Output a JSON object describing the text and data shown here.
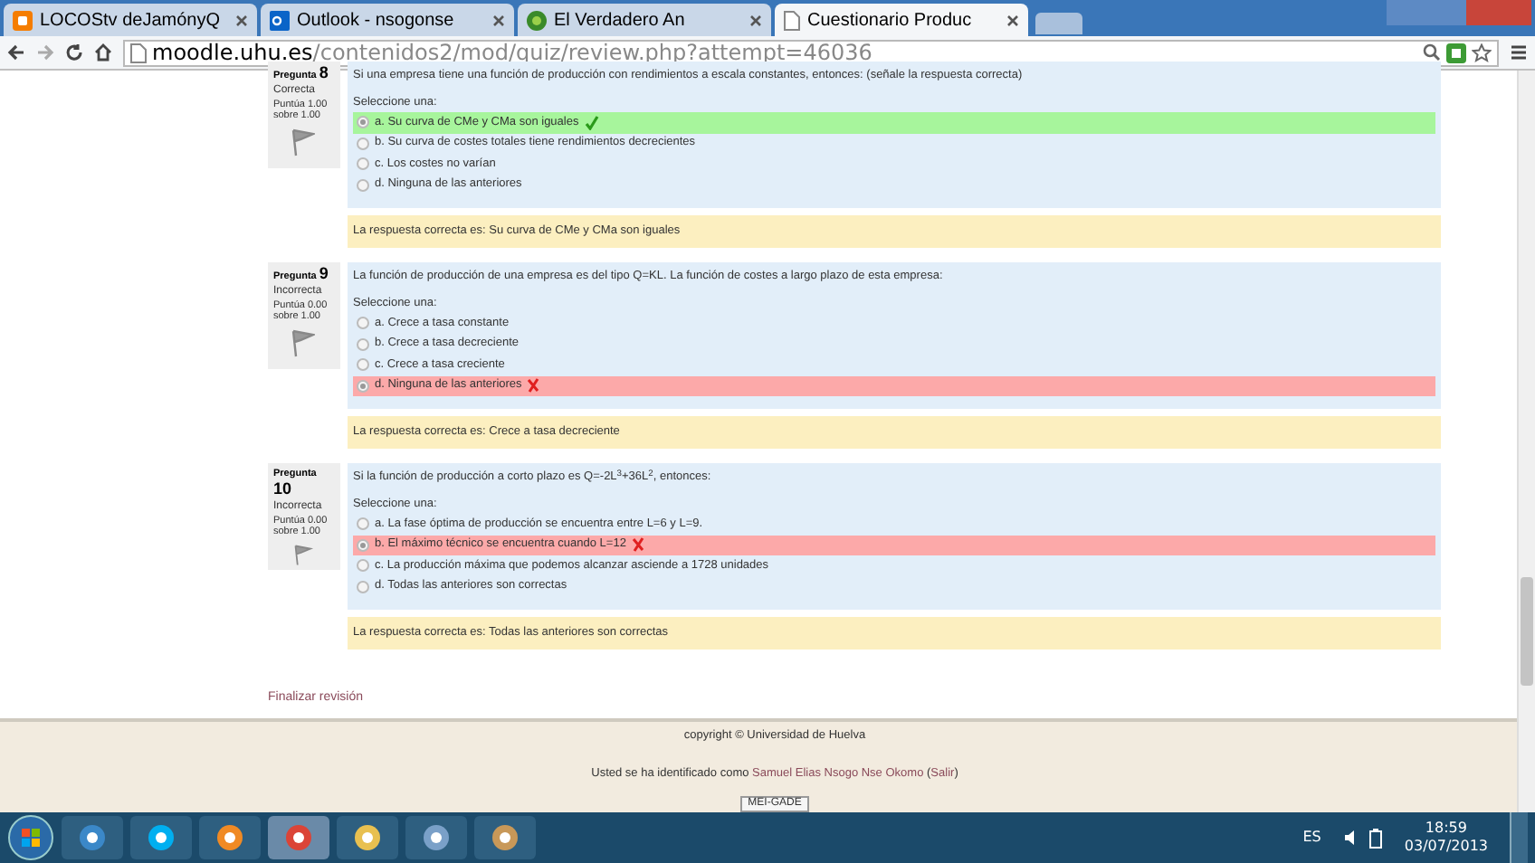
{
  "browser": {
    "tabs": [
      {
        "title": "LOCOStv deJamónyQ",
        "selected": false,
        "kind": "blogger"
      },
      {
        "title": "Outlook - nsogonse",
        "selected": false,
        "kind": "outlook"
      },
      {
        "title": "El Verdadero An",
        "selected": false,
        "kind": "frog"
      },
      {
        "title": "Cuestionario Produc",
        "selected": true,
        "kind": "page"
      }
    ],
    "url_host": "moodle.uhu.es",
    "url_path": "/contenidos2/mod/quiz/review.php?attempt=46036"
  },
  "questions": [
    {
      "label": "Pregunta",
      "number": "8",
      "state": "Correcta",
      "score": "Puntúa 1.00 sobre 1.00",
      "text": "Si una empresa tiene una función de producción con rendimientos a escala constantes, entonces: (señale la respuesta correcta)",
      "prompt": "Seleccione una:",
      "options": [
        {
          "text": "a. Su curva de CMe y CMa son iguales",
          "selected": true,
          "kind": "correct"
        },
        {
          "text": "b. Su curva de costes totales tiene rendimientos decrecientes",
          "selected": false,
          "kind": "plain"
        },
        {
          "text": "c. Los costes no varían",
          "selected": false,
          "kind": "plain"
        },
        {
          "text": "d. Ninguna de las anteriores",
          "selected": false,
          "kind": "plain"
        }
      ],
      "feedback": "La respuesta correcta es: Su curva de CMe y CMa son iguales"
    },
    {
      "label": "Pregunta",
      "number": "9",
      "state": "Incorrecta",
      "score": "Puntúa 0.00 sobre 1.00",
      "text": "La función de producción de una empresa es del tipo Q=KL. La función de costes a largo plazo de esta empresa:",
      "prompt": "Seleccione una:",
      "options": [
        {
          "text": "a. Crece a tasa constante",
          "selected": false,
          "kind": "plain"
        },
        {
          "text": "b. Crece a tasa decreciente",
          "selected": false,
          "kind": "plain"
        },
        {
          "text": "c. Crece a tasa creciente",
          "selected": false,
          "kind": "plain"
        },
        {
          "text": "d. Ninguna de las anteriores",
          "selected": true,
          "kind": "incorrect"
        }
      ],
      "feedback": "La respuesta correcta es: Crece a tasa decreciente"
    },
    {
      "label": "Pregunta",
      "number": "10",
      "state": "Incorrecta",
      "score": "Puntúa 0.00 sobre 1.00",
      "text": "Si la función de producción a corto plazo es Q=-2L$^{3}$+36L$^{2}$, entonces:",
      "prompt": "Seleccione una:",
      "options": [
        {
          "text": "a. La fase óptima de producción se encuentra entre L=6 y L=9.",
          "selected": false,
          "kind": "plain"
        },
        {
          "text": "b. El máximo técnico se encuentra cuando L=12",
          "selected": true,
          "kind": "incorrect"
        },
        {
          "text": "c. La producción máxima que podemos alcanzar asciende a 1728 unidades",
          "selected": false,
          "kind": "plain"
        },
        {
          "text": "d. Todas las anteriores son correctas",
          "selected": false,
          "kind": "plain"
        }
      ],
      "feedback": "La respuesta correcta es: Todas las anteriores son correctas"
    }
  ],
  "finish_link": "Finalizar revisión",
  "footer": {
    "copyright": "copyright © Universidad de Huelva",
    "login_prefix": "Usted se ha identificado como",
    "user": "Samuel Elias Nsogo Nse Okomo",
    "logout_open": "(",
    "logout": "Salir",
    "logout_close": ")",
    "badge": "MEI-GADE"
  },
  "taskbar": {
    "language": "ES",
    "time": "18:59",
    "date": "03/07/2013"
  }
}
